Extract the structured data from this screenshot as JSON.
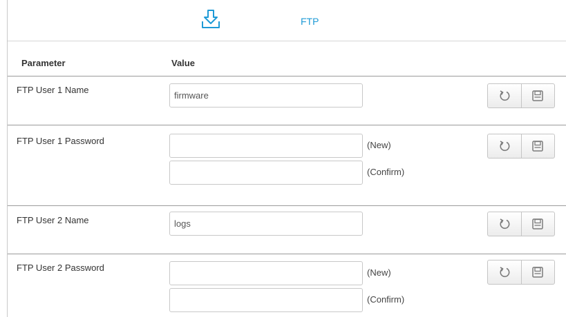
{
  "header": {
    "tab_label": "FTP",
    "icon": "download-tray-icon",
    "accent_color": "#1e9ad6"
  },
  "table": {
    "col_parameter": "Parameter",
    "col_value": "Value"
  },
  "rows": [
    {
      "label": "FTP User 1 Name",
      "value": "firmware",
      "type": "text"
    },
    {
      "label": "FTP User 1 Password",
      "new_value": "",
      "confirm_value": "",
      "new_hint": "(New)",
      "confirm_hint": "(Confirm)",
      "type": "password"
    },
    {
      "label": "FTP User 2 Name",
      "value": "logs",
      "type": "text"
    },
    {
      "label": "FTP User 2 Password",
      "new_value": "",
      "confirm_value": "",
      "new_hint": "(New)",
      "confirm_hint": "(Confirm)",
      "type": "password"
    }
  ],
  "actions": {
    "reset_icon": "undo-icon",
    "save_icon": "save-icon"
  }
}
